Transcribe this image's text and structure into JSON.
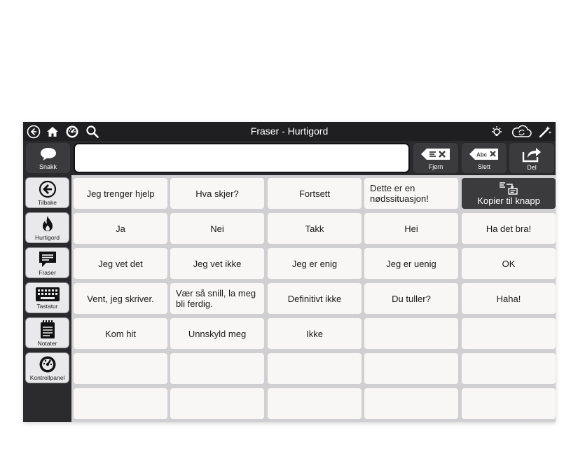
{
  "titlebar": {
    "title": "Fraser - Hurtigord",
    "icons": [
      "back-circle-icon",
      "home-icon",
      "dashboard-icon",
      "search-icon",
      "lightbulb-icon",
      "cloud-sync-icon",
      "magic-wand-icon"
    ]
  },
  "message": {
    "speak_label": "Snakk",
    "text": "",
    "buttons": [
      {
        "label": "Fjern",
        "icon": "clear-text-icon"
      },
      {
        "label": "Slett",
        "icon": "delete-word-icon"
      },
      {
        "label": "Del",
        "icon": "share-icon"
      }
    ]
  },
  "sidebar": {
    "items": [
      {
        "label": "Tilbake",
        "icon": "back-arrow-icon"
      },
      {
        "label": "Hurtigord",
        "icon": "fire-icon"
      },
      {
        "label": "Fraser",
        "icon": "speech-bubble-icon"
      },
      {
        "label": "Tastatur",
        "icon": "keyboard-icon"
      },
      {
        "label": "Notater",
        "icon": "notepad-icon"
      },
      {
        "label": "Kontrollpanel",
        "icon": "dashboard-icon"
      }
    ]
  },
  "grid": {
    "copy_button": "Kopier til knapp",
    "rows": [
      [
        "Jeg trenger hjelp",
        "Hva skjer?",
        "Fortsett",
        "Dette er en nødssituasjon!",
        ""
      ],
      [
        "Ja",
        "Nei",
        "Takk",
        "Hei",
        "Ha det bra!"
      ],
      [
        "Jeg vet det",
        "Jeg vet ikke",
        "Jeg er enig",
        "Jeg er uenig",
        "OK"
      ],
      [
        "Vent, jeg skriver.",
        "Vær så snill, la meg bli ferdig.",
        "Definitivt ikke",
        "Du tuller?",
        "Haha!"
      ],
      [
        "Kom hit",
        "Unnskyld meg",
        "Ikke",
        "",
        ""
      ],
      [
        "",
        "",
        "",
        "",
        ""
      ],
      [
        "",
        "",
        "",
        "",
        ""
      ]
    ]
  },
  "colors": {
    "titlebar": "#1f1f21",
    "toolbar": "#2a2a2c",
    "dark_button": "#3b3b3d",
    "cell": "#f8f7f5",
    "grid_bg": "#d0d0d2"
  }
}
